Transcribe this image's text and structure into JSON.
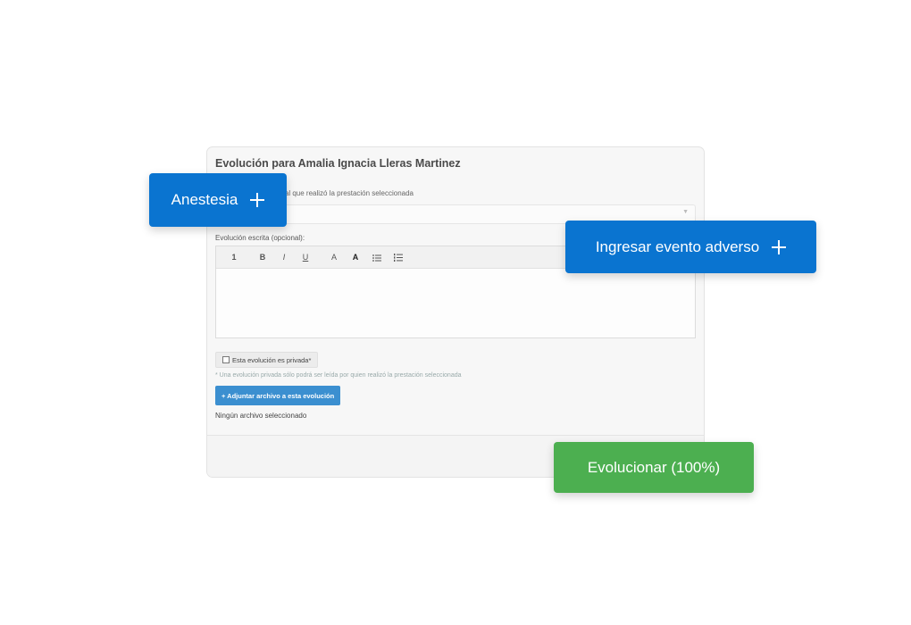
{
  "form": {
    "title": "Evolución para Amalia Ignacia Lleras Martinez",
    "professional_label": "onal que realizó la prestación seleccionada",
    "professional_value": "",
    "evolution_label": "Evolución escrita (opcional):",
    "toolbar": {
      "heading": "1",
      "bold": "B",
      "italic": "I",
      "underline": "U",
      "font_color": "A",
      "bg_color": "A",
      "bullet_list_icon": "bullet-list-icon",
      "numbered_list_icon": "numbered-list-icon"
    },
    "editor_value": "",
    "private_checkbox_label": "Esta evolución es privada*",
    "private_note": "* Una evolución privada sólo podrá ser leída por quien realizó la prestación seleccionada",
    "attach_button_label": "+ Adjuntar archivo a esta evolución",
    "attach_status": "Ningún archivo seleccionado"
  },
  "floating_buttons": {
    "anesthesia_label": "Anestesia",
    "adverse_event_label": "Ingresar evento adverso",
    "evolve_label": "Evolucionar (100%)"
  },
  "colors": {
    "primary_blue": "#0a74d0",
    "success_green": "#4caf50",
    "attach_blue": "#3b8fd0"
  }
}
